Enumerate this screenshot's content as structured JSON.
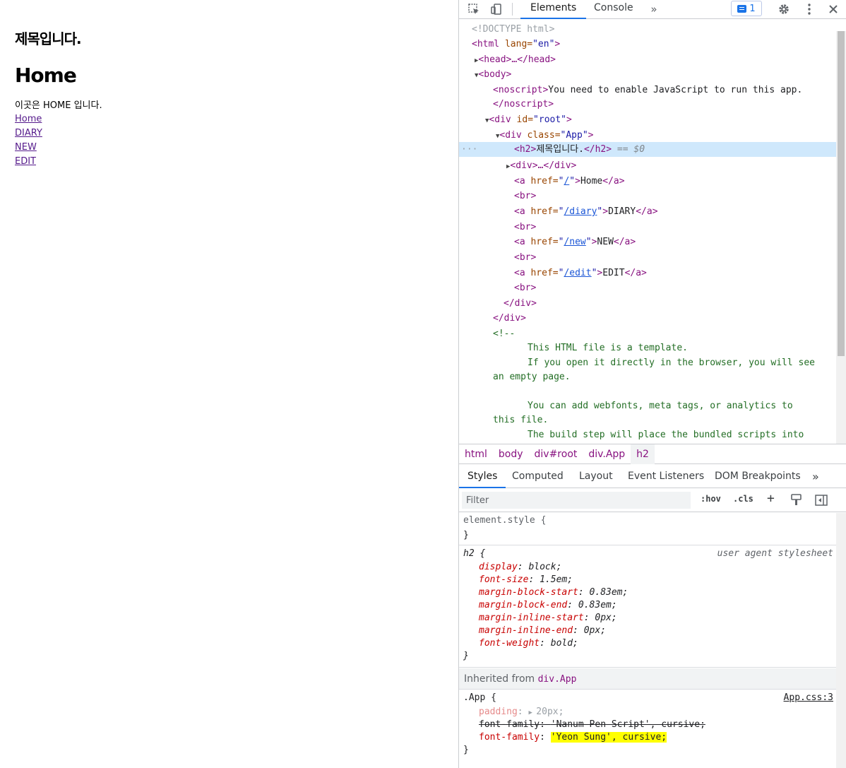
{
  "page": {
    "title": "제목입니다.",
    "heading": "Home",
    "text": "이곳은 HOME 입니다.",
    "links": [
      "Home",
      "DIARY",
      "NEW",
      "EDIT"
    ]
  },
  "devtools": {
    "tabs": [
      "Elements",
      "Console"
    ],
    "issues_count": "1",
    "dom": {
      "doctype": "<!DOCTYPE html>",
      "html_open_tag": "<html",
      "html_lang_attr": " lang=",
      "html_lang_val": "\"en\"",
      "head": "<head>…</head>",
      "body": "<body>",
      "noscript_open": "<noscript>",
      "noscript_text": "You need to enable JavaScript to run this app.",
      "noscript_close": "</noscript>",
      "root_tag": "<div",
      "root_attr": " id=",
      "root_val": "\"root\"",
      "app_attr": " class=",
      "app_val": "\"App\"",
      "h2_open": "<h2>",
      "h2_text": "제목입니다.",
      "h2_close": "</h2>",
      "selected_marker": " == $0",
      "div_collapsed": "<div>…</div>",
      "a_open": "<a",
      "href_attr": " href=",
      "br": "<br>",
      "a_close": "</a>",
      "div_close": "</div>",
      "links": [
        {
          "href": "/",
          "text": "Home"
        },
        {
          "href": "/diary",
          "text": "DIARY"
        },
        {
          "href": "/new",
          "text": "NEW"
        },
        {
          "href": "/edit",
          "text": "EDIT"
        }
      ],
      "comment_open": "<!--",
      "comment_lines": [
        "This HTML file is a template.",
        "If you open it directly in the browser, you will see",
        "an empty page.",
        "",
        "You can add webfonts, meta tags, or analytics to",
        "this file.",
        "The build step will place the bundled scripts into"
      ]
    },
    "breadcrumbs": [
      "html",
      "body",
      "div#root",
      "div.App",
      "h2"
    ],
    "style_tabs": [
      "Styles",
      "Computed",
      "Layout",
      "Event Listeners",
      "DOM Breakpoints"
    ],
    "filter_placeholder": "Filter",
    "filter_buttons": [
      ":hov",
      ".cls",
      "+"
    ],
    "styles": {
      "element_style": "element.style {",
      "close_brace": "}",
      "h2_selector": "h2 {",
      "ua_label": "user agent stylesheet",
      "h2_props": [
        {
          "name": "display",
          "value": "block;"
        },
        {
          "name": "font-size",
          "value": "1.5em;"
        },
        {
          "name": "margin-block-start",
          "value": "0.83em;"
        },
        {
          "name": "margin-block-end",
          "value": "0.83em;"
        },
        {
          "name": "margin-inline-start",
          "value": "0px;"
        },
        {
          "name": "margin-inline-end",
          "value": "0px;"
        },
        {
          "name": "font-weight",
          "value": "bold;"
        }
      ],
      "inherited_label": "Inherited from ",
      "inherited_tag": "div.App",
      "app_selector": ".App {",
      "app_source": "App.css:3",
      "padding_name": "padding",
      "padding_value": "20px;",
      "ff_struck_name": "font-family",
      "ff_struck_value": "'Nanum Pen Script', cursive;",
      "ff_name": "font-family",
      "ff_value": "'Yeon Sung', cursive;"
    }
  }
}
